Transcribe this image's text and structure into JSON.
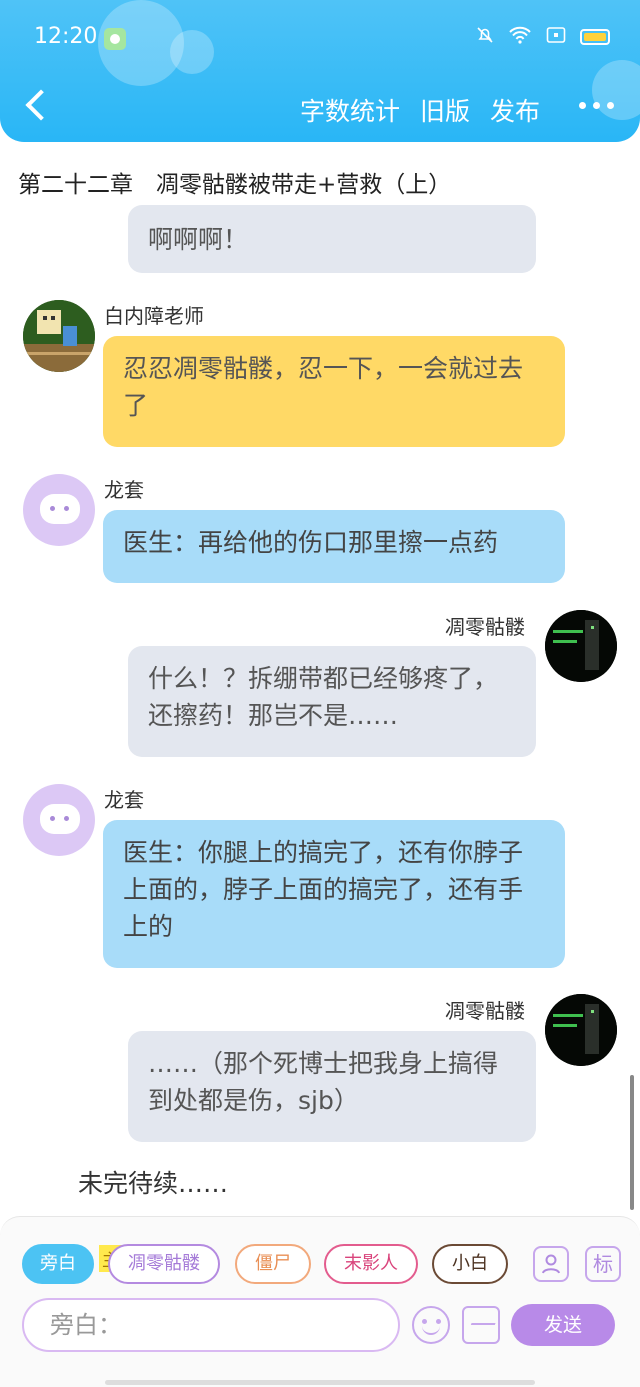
{
  "status_bar": {
    "time": "12:20"
  },
  "header": {
    "actions": [
      "字数统计",
      "旧版",
      "发布"
    ]
  },
  "chapter_title": "第二十二章　凋零骷髅被带走+营救（上）",
  "messages": [
    {
      "id": "m0",
      "text": "啊啊啊！"
    },
    {
      "id": "m1",
      "sender": "白内障老师",
      "text": "忍忍凋零骷髅，忍一下，一会就过去了"
    },
    {
      "id": "m2",
      "sender": "龙套",
      "text": "医生：再给他的伤口那里擦一点药"
    },
    {
      "id": "m3",
      "sender": "凋零骷髅",
      "text": "什么！？拆绷带都已经够疼了，还擦药！那岂不是……"
    },
    {
      "id": "m4",
      "sender": "龙套",
      "text": "医生：你腿上的搞完了，还有你脖子上面的，脖子上面的搞完了，还有手上的"
    },
    {
      "id": "m5",
      "sender": "凋零骷髅",
      "text": "……（那个死博士把我身上搞得到处都是伤，sjb）"
    }
  ],
  "end_text": "未完待续……",
  "composer": {
    "roles": [
      "旁白",
      "凋零骷髅",
      "僵尸",
      "末影人",
      "小白"
    ],
    "main_tag": "主",
    "tool_label": "标",
    "input_placeholder": "旁白：",
    "send_label": "发送"
  },
  "colors": {
    "header": "#29b6f6",
    "bubble_gray": "#e3e7ef",
    "bubble_yellow": "#ffd966",
    "bubble_blue": "#a8dcf9",
    "send": "#b88ae8"
  },
  "icons": [
    "back-icon",
    "more-icon",
    "bell-off-icon",
    "wifi-icon",
    "battery-icon",
    "person-icon",
    "emoji-icon",
    "image-icon"
  ]
}
